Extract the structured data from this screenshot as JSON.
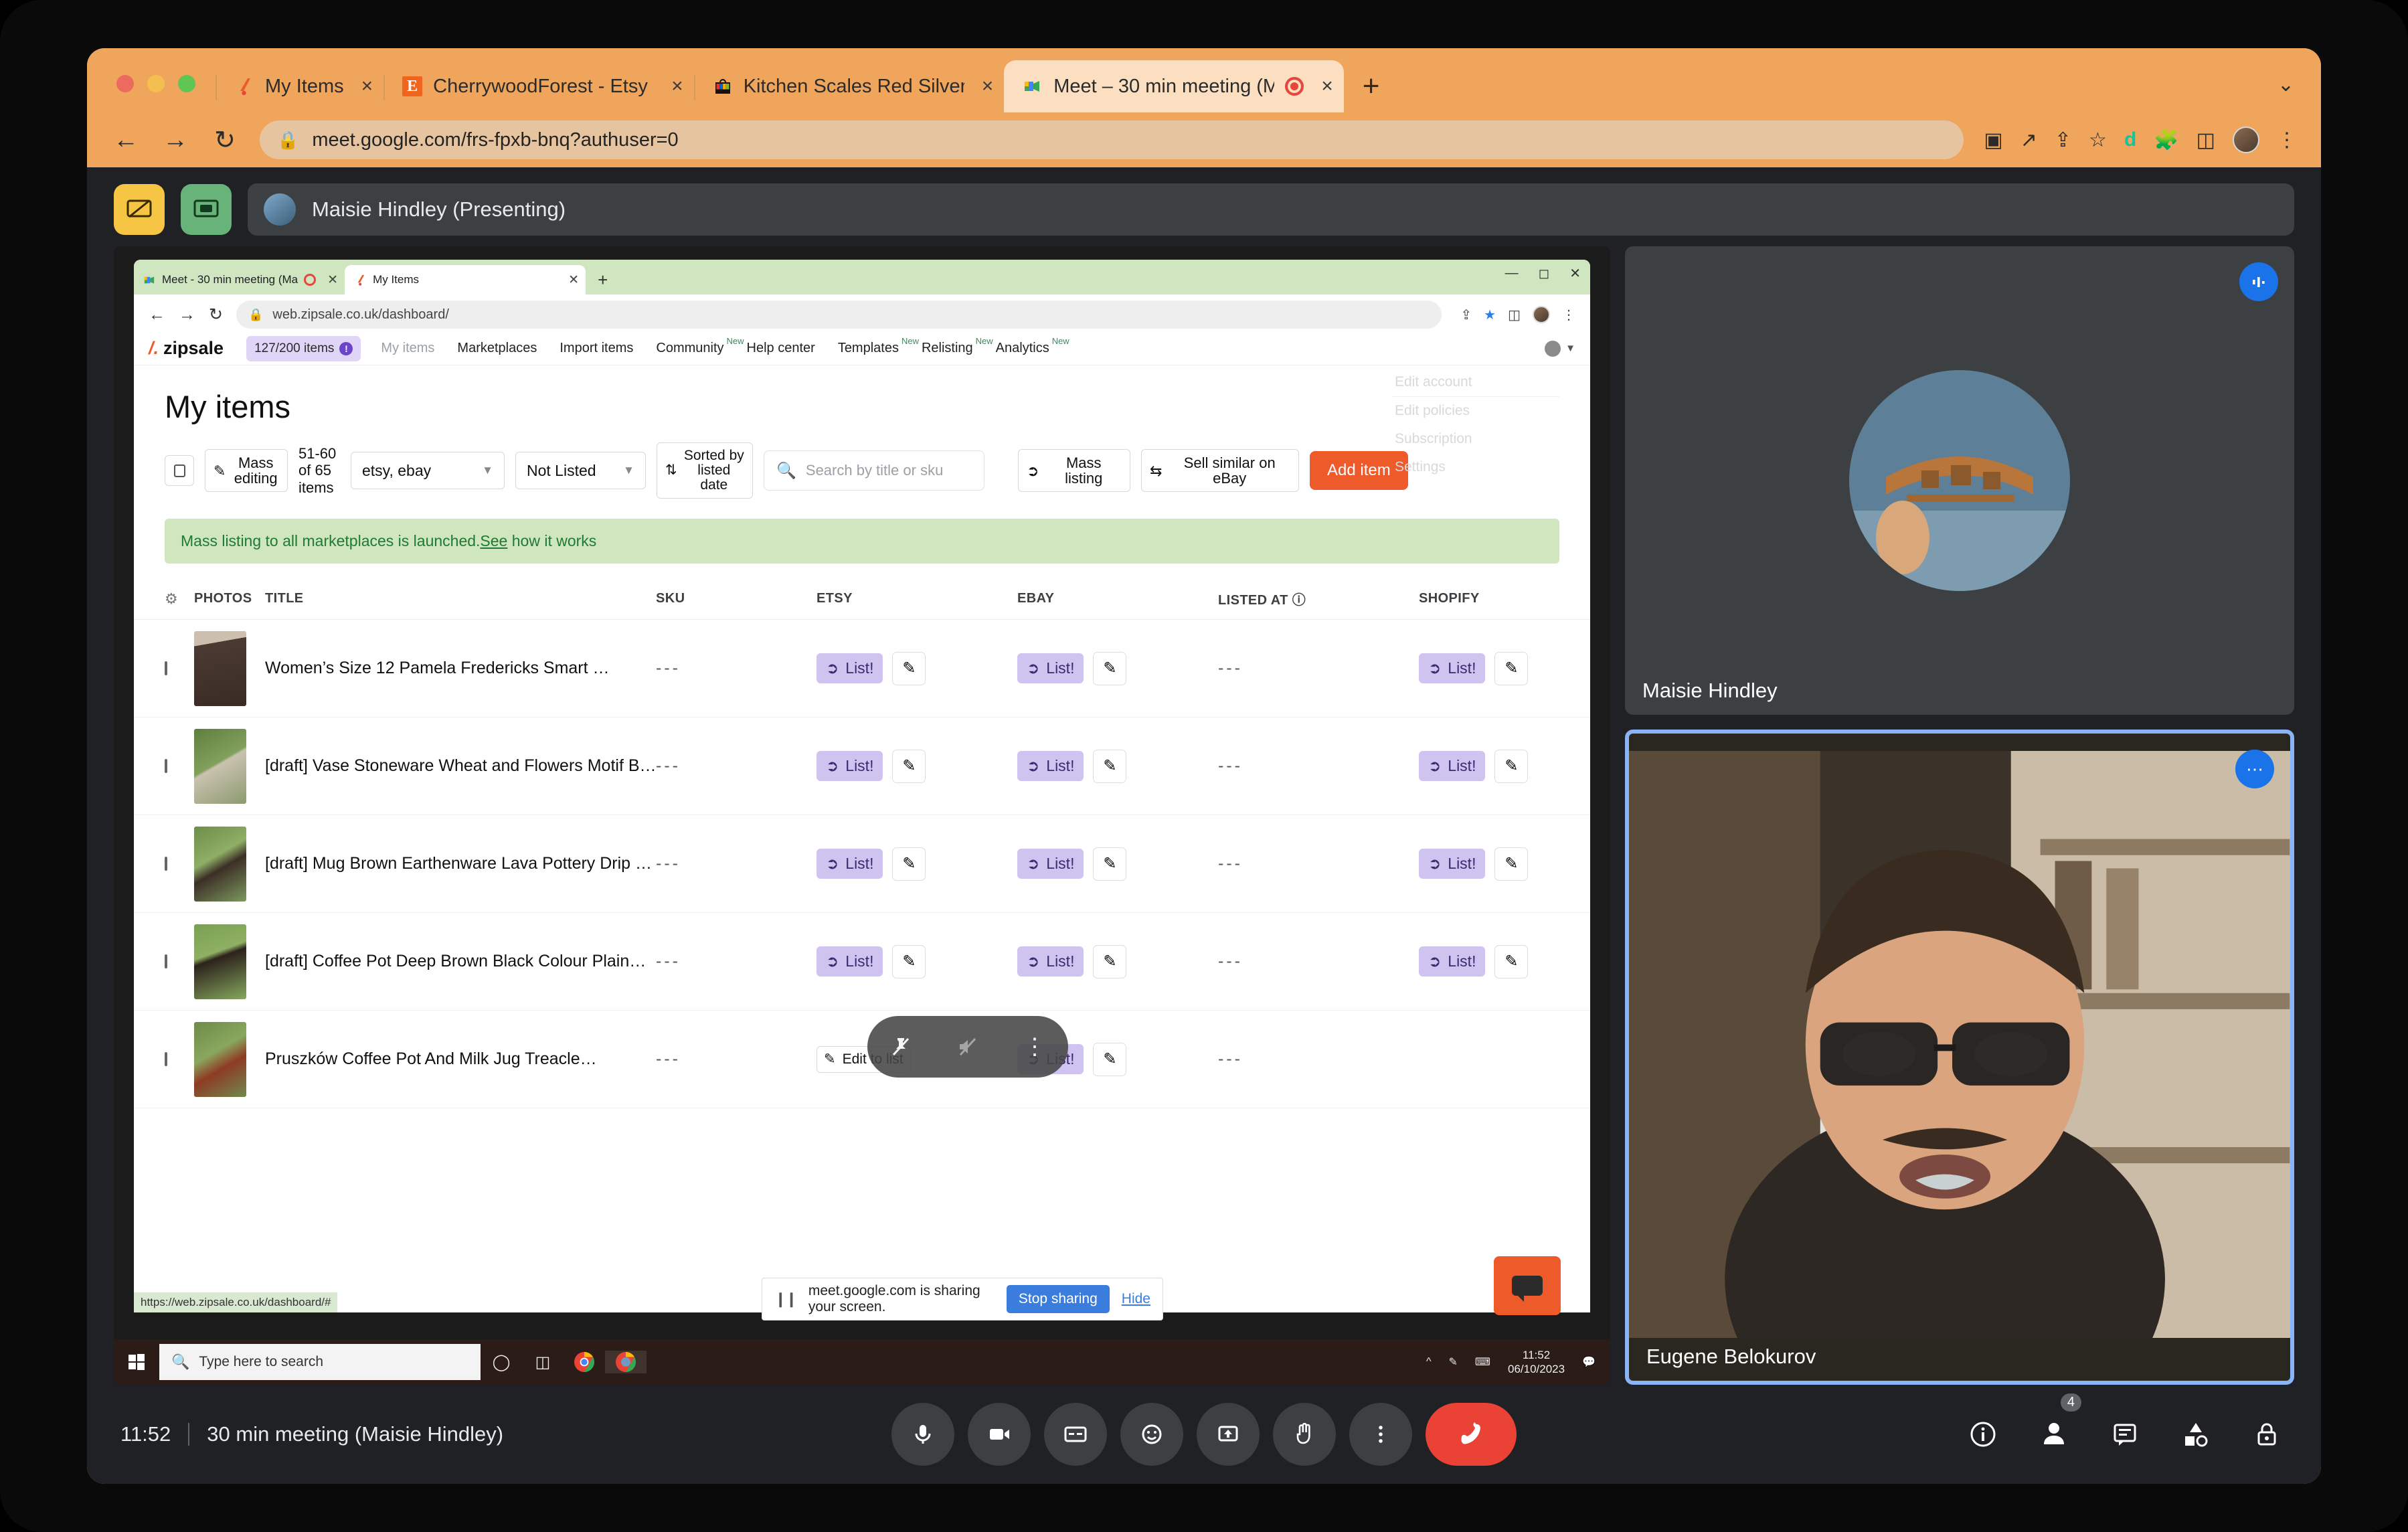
{
  "browser": {
    "tabs": [
      {
        "title": "My Items",
        "icon": "zipsale-icon",
        "active": false,
        "recording": false
      },
      {
        "title": "CherrywoodForest - Etsy UK",
        "icon": "etsy-icon",
        "active": false,
        "recording": false
      },
      {
        "title": "Kitchen Scales Red Silver Met",
        "icon": "ebay-icon",
        "active": false,
        "recording": false
      },
      {
        "title": "Meet – 30 min meeting (M",
        "icon": "google-meet-icon",
        "active": true,
        "recording": true
      }
    ],
    "new_tab_label": "+",
    "tab_close_label": "×",
    "tabstrip_chevron": "⌄",
    "omnibox": {
      "url": "meet.google.com/frs-fpxb-bnq?authuser=0",
      "lock_icon": "lock-icon"
    },
    "nav": {
      "back": "←",
      "forward": "→",
      "reload": "↻"
    },
    "omni_icons": [
      "video-camera-icon",
      "open-in-new-icon",
      "share-icon",
      "star-icon",
      "grammarly-icon",
      "extensions-icon",
      "side-panel-icon",
      "profile-avatar",
      "kebab-menu-icon"
    ]
  },
  "meet": {
    "presenting_banner": "Maisie Hindley (Presenting)",
    "left_buttons": [
      "present-stop-icon",
      "cast-screen-icon"
    ],
    "bottom": {
      "time": "11:52",
      "meeting_name": "30 min meeting (Maisie Hindley)",
      "controls": [
        {
          "name": "microphone-button",
          "icon": "mic"
        },
        {
          "name": "camera-button",
          "icon": "cam"
        },
        {
          "name": "captions-button",
          "icon": "cc"
        },
        {
          "name": "reactions-button",
          "icon": "emoji"
        },
        {
          "name": "present-now-button",
          "icon": "present"
        },
        {
          "name": "raise-hand-button",
          "icon": "hand"
        },
        {
          "name": "more-options-button",
          "icon": "kebab"
        },
        {
          "name": "leave-call-button",
          "icon": "hangup"
        }
      ],
      "right_controls": [
        {
          "name": "meeting-details-button",
          "icon": "info",
          "count": ""
        },
        {
          "name": "participants-button",
          "icon": "people",
          "count": "4"
        },
        {
          "name": "chat-button",
          "icon": "chat",
          "count": ""
        },
        {
          "name": "activities-button",
          "icon": "activities",
          "count": ""
        },
        {
          "name": "host-controls-button",
          "icon": "lock",
          "count": ""
        }
      ]
    },
    "tiles": [
      {
        "name": "Maisie Hindley",
        "badge": "audio-indicator"
      },
      {
        "name": "Eugene Belokurov",
        "badge": "more-options"
      }
    ]
  },
  "shared_screen": {
    "inner_browser": {
      "tabs": [
        {
          "title": "Meet - 30 min meeting (Ma",
          "icon": "google-meet-icon",
          "active": false,
          "recording": true
        },
        {
          "title": "My Items",
          "icon": "zipsale-icon",
          "active": true,
          "recording": false
        }
      ],
      "new_tab_label": "+",
      "window_controls": [
        "minimize",
        "maximize",
        "close"
      ],
      "omnibox_url": "web.zipsale.co.uk/dashboard/"
    },
    "zipsale": {
      "brand": "zipsale",
      "item_counter": "127/200 items",
      "item_counter_badge": "!",
      "nav_links": [
        {
          "label": "My items",
          "new": false,
          "active": true
        },
        {
          "label": "Marketplaces",
          "new": false,
          "active": false
        },
        {
          "label": "Import items",
          "new": false,
          "active": false
        },
        {
          "label": "Community",
          "new": true,
          "active": false
        },
        {
          "label": "Help center",
          "new": false,
          "active": false
        },
        {
          "label": "Templates",
          "new": true,
          "active": false
        },
        {
          "label": "Relisting",
          "new": true,
          "active": false
        },
        {
          "label": "Analytics",
          "new": true,
          "active": false
        }
      ],
      "new_tag": "New",
      "account_menu": [
        "Edit account",
        "Edit policies",
        "Subscription",
        "Settings"
      ],
      "page_title": "My items",
      "toolbar": {
        "mass_editing": "Mass editing",
        "pagination": "51-60 of 65 items",
        "marketplace_filter": "etsy, ebay",
        "status_filter": "Not Listed",
        "sort_label": "Sorted by listed date",
        "search_placeholder": "Search by title or sku",
        "mass_listing": "Mass listing",
        "sell_similar": "Sell similar on eBay",
        "add_item": "Add item"
      },
      "banner": {
        "text": "Mass listing to all marketplaces is launched.",
        "link": "See",
        "suffix": " how it works"
      },
      "table": {
        "headers": [
          "PHOTOS",
          "TITLE",
          "SKU",
          "ETSY",
          "EBAY",
          "LISTED AT",
          "SHOPIFY"
        ],
        "rows": [
          {
            "title": "Women’s Size 12 Pamela Fredericks Smart …",
            "sku": "---",
            "etsy": "List!",
            "ebay": "List!",
            "listed_at": "---",
            "shopify": "List!",
            "thumb": "dress"
          },
          {
            "title": "[draft] Vase Stoneware Wheat and Flowers Motif B…",
            "sku": "---",
            "etsy": "List!",
            "ebay": "List!",
            "listed_at": "---",
            "shopify": "List!",
            "thumb": "vase"
          },
          {
            "title": "[draft] Mug Brown Earthenware Lava Pottery Drip …",
            "sku": "---",
            "etsy": "List!",
            "ebay": "List!",
            "listed_at": "---",
            "shopify": "List!",
            "thumb": "mug"
          },
          {
            "title": "[draft] Coffee Pot Deep Brown Black Colour Plain…",
            "sku": "---",
            "etsy": "List!",
            "ebay": "List!",
            "listed_at": "---",
            "shopify": "List!",
            "thumb": "pot"
          },
          {
            "title": "Pruszków Coffee Pot And Milk Jug Treacle…",
            "sku": "---",
            "etsy": "Edit to list",
            "ebay": "List!",
            "listed_at": "---",
            "shopify": "",
            "thumb": "jugs"
          }
        ]
      },
      "status_link": "https://web.zipsale.co.uk/dashboard/#"
    },
    "presenter_float": [
      "unpin-icon",
      "mute-icon",
      "more-vert-icon"
    ],
    "share_infobar": {
      "message": "meet.google.com is sharing your screen.",
      "stop_label": "Stop sharing",
      "hide_label": "Hide"
    },
    "taskbar": {
      "search_placeholder": "Type here to search",
      "time": "11:52",
      "date": "06/10/2023",
      "icons": [
        "start-icon",
        "cortana-icon",
        "task-view-icon",
        "chrome-icon",
        "chrome-icon-2",
        "show-hidden-icons",
        "pen-icon",
        "keyboard-icon",
        "notifications-icon"
      ]
    }
  },
  "colors": {
    "chrome_orange": "#f0a55c",
    "meet_dark": "#202124",
    "accent_blue": "#8ab4f8",
    "hangup_red": "#ea4335",
    "zipsale_orange": "#ef5a2a",
    "list_purple": "#cfc3ef",
    "banner_green": "#cfe6bf"
  }
}
